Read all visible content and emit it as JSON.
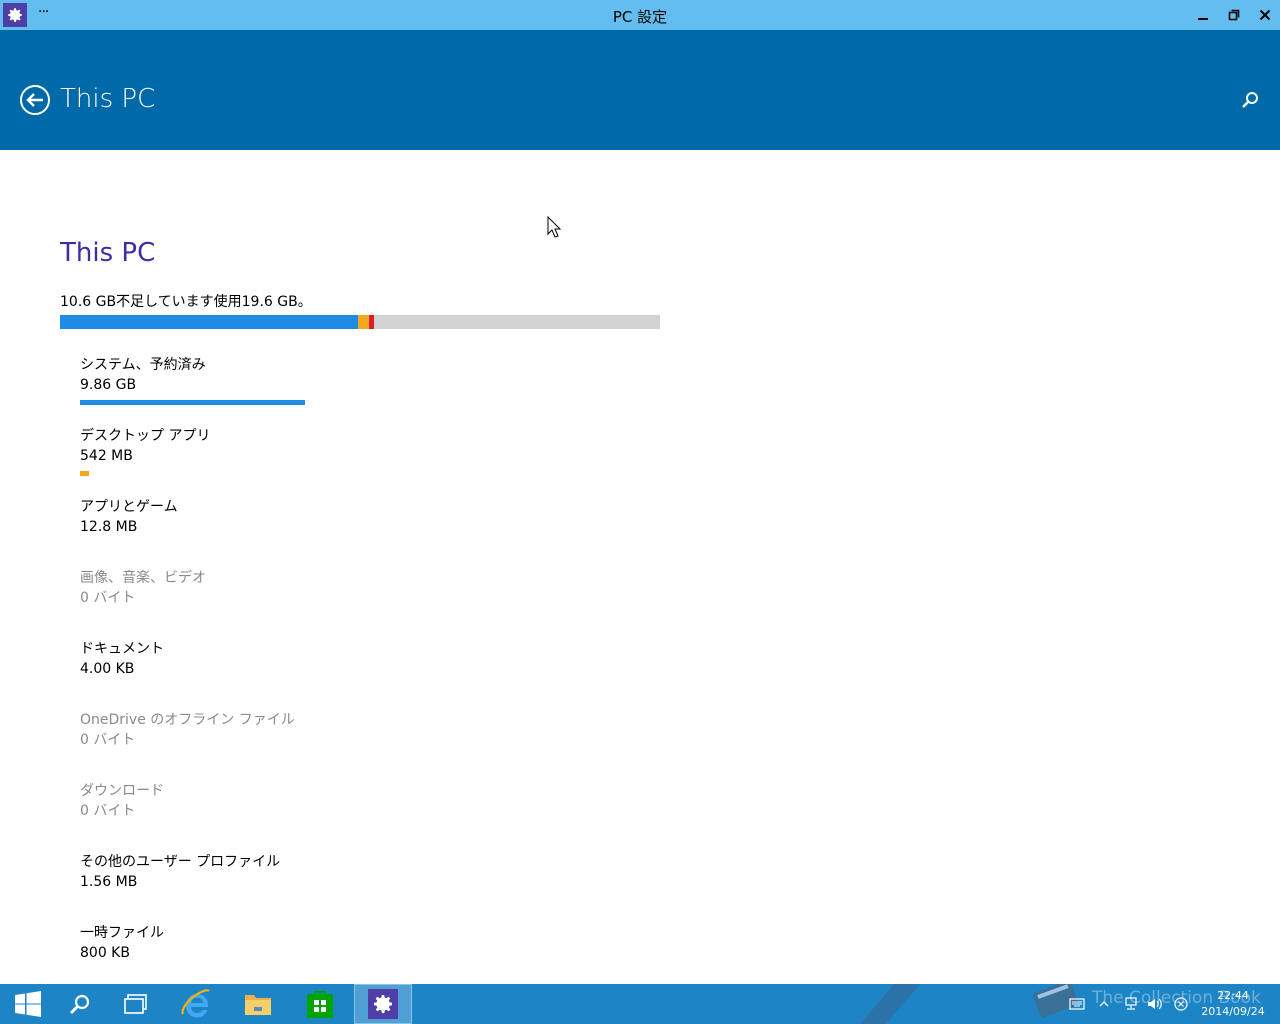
{
  "window": {
    "title": "PC 設定",
    "menu_glyph": "···"
  },
  "header": {
    "title": "This PC"
  },
  "content": {
    "section_title": "This PC",
    "summary": "10.6 GB不足しています使用19.6 GB。",
    "storage_bar": {
      "system_fraction": 0.4967,
      "desktop_fraction": 0.0183,
      "apps_fraction": 0.0083,
      "colors": {
        "system": "#1e8ce6",
        "desktop": "#f4a81d",
        "apps": "#d61f2b",
        "free": "#d2d2d2"
      }
    },
    "items": [
      {
        "name": "システム、予約済み",
        "size": "9.86 GB",
        "bar_fraction": 0.375,
        "bar_color": "#1e8ce6",
        "dim": false
      },
      {
        "name": "デスクトップ アプリ",
        "size": "542 MB",
        "bar_fraction": 0.015,
        "bar_color": "#f4a81d",
        "dim": false
      },
      {
        "name": "アプリとゲーム",
        "size": "12.8 MB",
        "bar_fraction": 0,
        "bar_color": "#d61f2b",
        "dim": false
      },
      {
        "name": "画像、音楽、ビデオ",
        "size": "0 バイト",
        "bar_fraction": 0,
        "bar_color": "#1e8ce6",
        "dim": true
      },
      {
        "name": "ドキュメント",
        "size": "4.00 KB",
        "bar_fraction": 0,
        "bar_color": "#1e8ce6",
        "dim": false
      },
      {
        "name": "OneDrive のオフライン ファイル",
        "size": "0 バイト",
        "bar_fraction": 0,
        "bar_color": "#1e8ce6",
        "dim": true
      },
      {
        "name": "ダウンロード",
        "size": "0 バイト",
        "bar_fraction": 0,
        "bar_color": "#1e8ce6",
        "dim": true
      },
      {
        "name": "その他のユーザー プロファイル",
        "size": "1.56 MB",
        "bar_fraction": 0,
        "bar_color": "#1e8ce6",
        "dim": false
      },
      {
        "name": "一時ファイル",
        "size": "800 KB",
        "bar_fraction": 0,
        "bar_color": "#1e8ce6",
        "dim": false
      }
    ]
  },
  "taskbar": {
    "clock_time": "22:44",
    "clock_date": "2014/09/24",
    "watermark": "The Collection Book"
  },
  "icons": [
    "gear-icon",
    "minimize-icon",
    "restore-icon",
    "close-icon",
    "back-arrow-icon",
    "search-icon",
    "windows-logo-icon",
    "taskbar-search-icon",
    "task-view-icon",
    "internet-explorer-icon",
    "file-explorer-icon",
    "store-icon",
    "settings-icon",
    "keyboard-icon",
    "show-hidden-icons-icon",
    "network-icon",
    "volume-icon",
    "notification-icon"
  ]
}
